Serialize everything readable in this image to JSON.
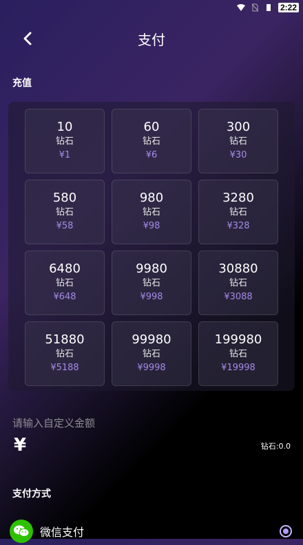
{
  "status_bar": {
    "time": "2:22"
  },
  "header": {
    "title": "支付"
  },
  "recharge": {
    "section_title": "充值",
    "packages": [
      {
        "amount": "10",
        "unit": "钻石",
        "price": "¥1"
      },
      {
        "amount": "60",
        "unit": "钻石",
        "price": "¥6"
      },
      {
        "amount": "300",
        "unit": "钻石",
        "price": "¥30"
      },
      {
        "amount": "580",
        "unit": "钻石",
        "price": "¥58"
      },
      {
        "amount": "980",
        "unit": "钻石",
        "price": "¥98"
      },
      {
        "amount": "3280",
        "unit": "钻石",
        "price": "¥328"
      },
      {
        "amount": "6480",
        "unit": "钻石",
        "price": "¥648"
      },
      {
        "amount": "9980",
        "unit": "钻石",
        "price": "¥998"
      },
      {
        "amount": "30880",
        "unit": "钻石",
        "price": "¥3088"
      },
      {
        "amount": "51880",
        "unit": "钻石",
        "price": "¥5188"
      },
      {
        "amount": "99980",
        "unit": "钻石",
        "price": "¥9998"
      },
      {
        "amount": "199980",
        "unit": "钻石",
        "price": "¥19998"
      }
    ]
  },
  "custom": {
    "label": "请输入自定义金额",
    "currency": "¥",
    "value": "",
    "diamonds": "钻石:0.0"
  },
  "payment": {
    "section_title": "支付方式",
    "methods": [
      {
        "name": "微信支付",
        "icon": "wechat-icon",
        "selected": true
      }
    ]
  },
  "colors": {
    "accent": "#a58be8",
    "wechat": "#2dc100"
  }
}
